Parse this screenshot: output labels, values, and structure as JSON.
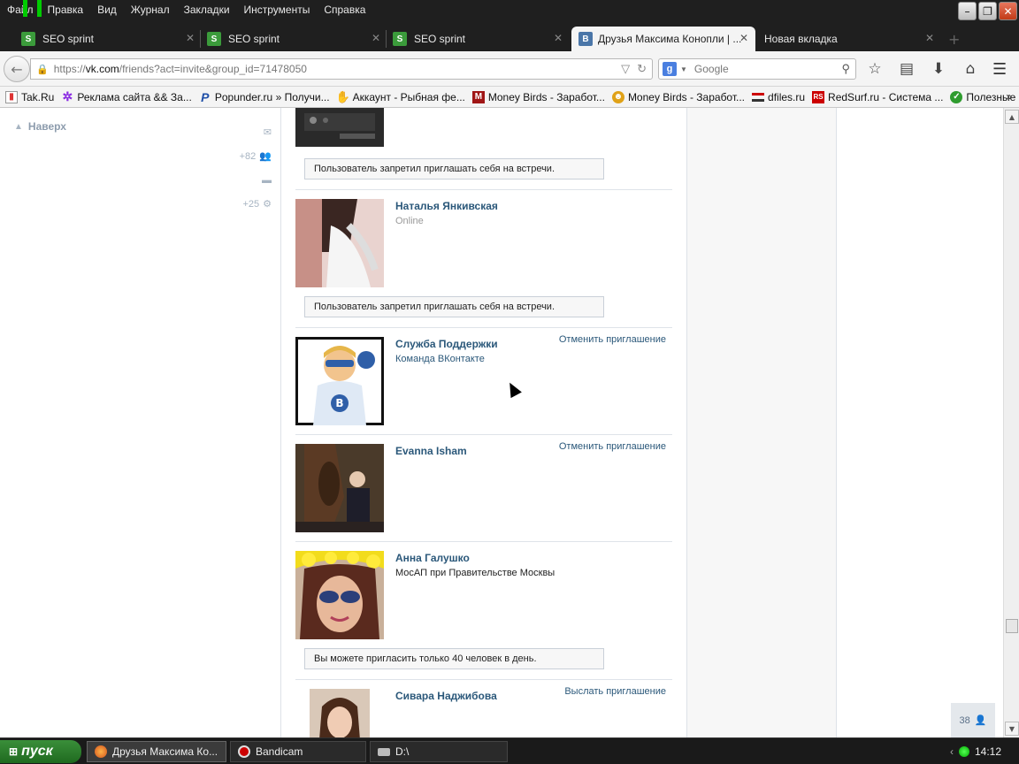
{
  "menu": [
    "Файл",
    "Правка",
    "Вид",
    "Журнал",
    "Закладки",
    "Инструменты",
    "Справка"
  ],
  "tabs": [
    {
      "label": "SEO sprint",
      "icon": "S"
    },
    {
      "label": "SEO sprint",
      "icon": "S"
    },
    {
      "label": "SEO sprint",
      "icon": "S"
    },
    {
      "label": "Друзья Максима Конопли | ...",
      "icon": "B"
    },
    {
      "label": "Новая вкладка",
      "icon": ""
    }
  ],
  "url": {
    "prefix": "https://",
    "host": "vk.com",
    "path": "/friends?act=invite&group_id=71478050"
  },
  "search": {
    "placeholder": "Google"
  },
  "bookmarks": [
    "Tak.Ru",
    "Реклама сайта && За...",
    "Popunder.ru » Получи...",
    "Аккаунт - Рыбная фе...",
    "Money Birds - Заработ...",
    "Money Birds - Заработ...",
    "dfiles.ru",
    "RedSurf.ru - Система ...",
    "Полезные советы, по..."
  ],
  "sidebar": {
    "to_top": "Наверх",
    "counters": [
      "",
      "+82",
      "",
      "+25"
    ]
  },
  "friends": [
    {
      "name": "",
      "status": "",
      "action": "",
      "notice": "Пользователь запретил приглашать себя на встречи."
    },
    {
      "name": "Наталья Янкивская",
      "status": "Online",
      "action": "",
      "notice": "Пользователь запретил приглашать себя на встречи."
    },
    {
      "name": "Служба Поддержки",
      "status": "Команда ВКонтакте",
      "action": "Отменить приглашение",
      "notice": ""
    },
    {
      "name": "Evanna Isham",
      "status": "",
      "action": "Отменить приглашение",
      "notice": ""
    },
    {
      "name": "Анна Галушко",
      "status": "МосАП при Правительстве Москвы",
      "action": "",
      "notice": "Вы можете пригласить только 40 человек в день."
    },
    {
      "name": "Сивара Наджибова",
      "status": "",
      "action": "Выслать приглашение",
      "notice": ""
    }
  ],
  "online_counter": "38",
  "taskbar": {
    "start": "пуск",
    "tasks": [
      "Друзья Максима Ко...",
      "Bandicam",
      "D:\\"
    ],
    "clock": "14:12"
  },
  "colors": {
    "link": "#2b587a",
    "accent_green": "#1f6a1f"
  }
}
